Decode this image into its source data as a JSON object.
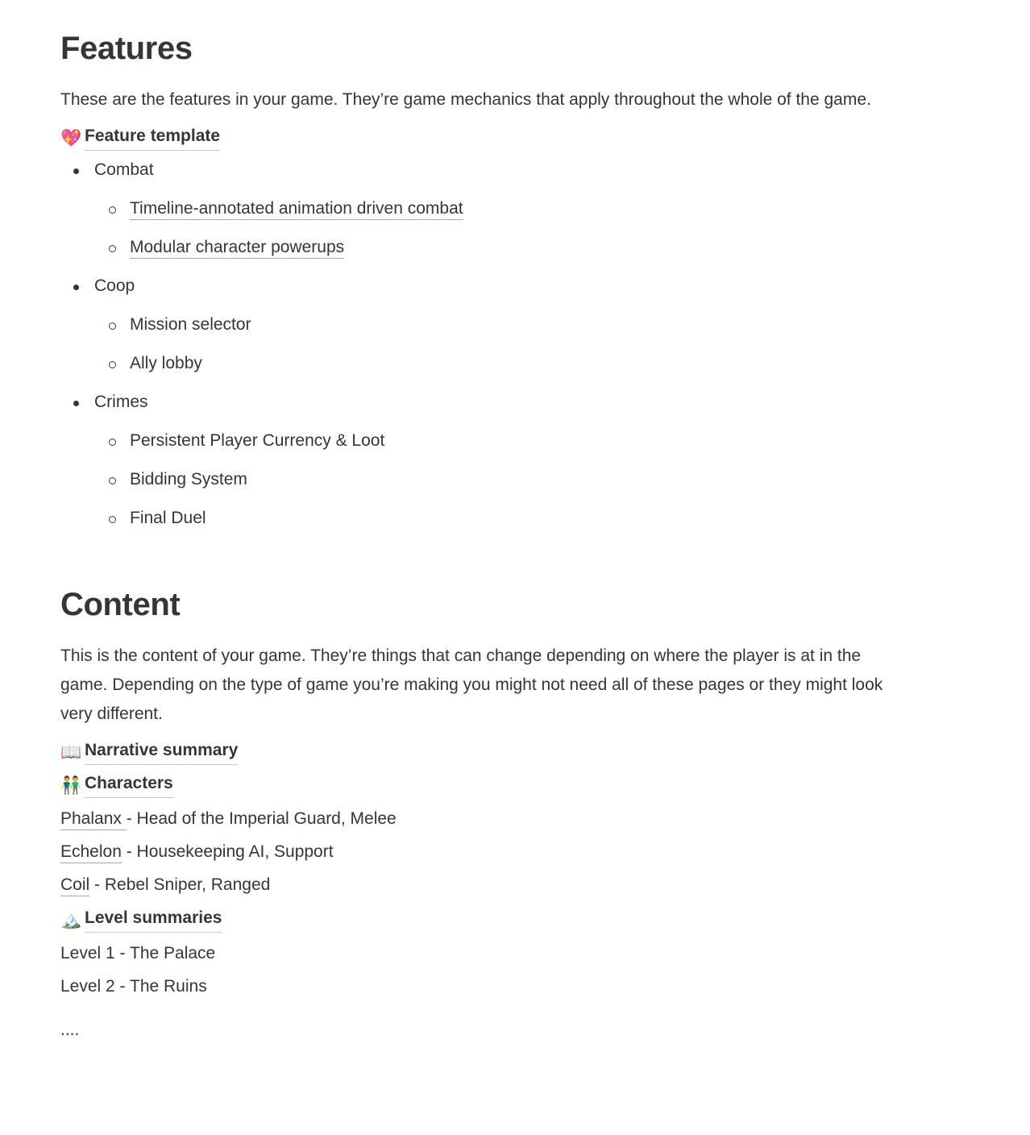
{
  "features_section": {
    "heading": "Features",
    "intro": "These are the features in your game. They’re game mechanics that apply throughout the whole of the game.",
    "template_link": {
      "emoji": "💖",
      "emoji_name": "sparkling-heart-icon",
      "label": "Feature template"
    },
    "groups": [
      {
        "label": "Combat",
        "children": [
          {
            "label": "Timeline-annotated animation driven combat",
            "is_link": true
          },
          {
            "label": "Modular character powerups",
            "is_link": true
          }
        ]
      },
      {
        "label": "Coop",
        "children": [
          {
            "label": "Mission selector",
            "is_link": false
          },
          {
            "label": "Ally lobby",
            "is_link": false
          }
        ]
      },
      {
        "label": "Crimes",
        "children": [
          {
            "label": "Persistent Player Currency & Loot",
            "is_link": false
          },
          {
            "label": "Bidding System",
            "is_link": false
          },
          {
            "label": "Final Duel",
            "is_link": false
          }
        ]
      }
    ]
  },
  "content_section": {
    "heading": "Content",
    "intro": "This is the content of your game. They’re things that can change depending on where the player is at in the game. Depending on the type of game you’re making you might not need all of these pages or they might look very different.",
    "narrative_link": {
      "emoji": "📖",
      "emoji_name": "open-book-icon",
      "label": "Narrative summary"
    },
    "characters_link": {
      "emoji": "👬",
      "emoji_name": "two-people-icon",
      "label": "Characters"
    },
    "characters": [
      {
        "name": "Phalanx ",
        "description": "- Head of the Imperial Guard, Melee"
      },
      {
        "name": "Echelon",
        "description": " - Housekeeping AI, Support"
      },
      {
        "name": "Coil",
        "description": " - Rebel Sniper, Ranged"
      }
    ],
    "levels_link": {
      "emoji": "🏔️",
      "emoji_name": "snow-capped-mountain-icon",
      "label": "Level summaries"
    },
    "levels": [
      "Level 1 - The Palace",
      "Level 2 - The Ruins"
    ],
    "ellipsis": "...."
  },
  "colors": {
    "text": "#37352f",
    "background": "#ffffff",
    "underline": "#a9a7a2"
  }
}
